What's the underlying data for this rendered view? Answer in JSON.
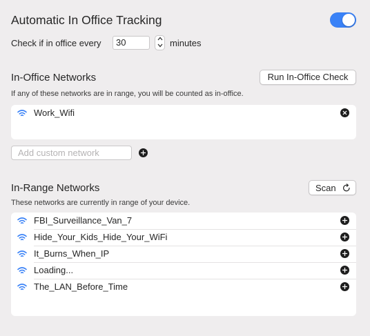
{
  "header": {
    "title": "Automatic In Office Tracking",
    "toggle_on": true
  },
  "interval": {
    "prefix": "Check if in office every",
    "value": "30",
    "suffix": "minutes"
  },
  "in_office": {
    "title": "In-Office Networks",
    "button": "Run In-Office Check",
    "description": "If any of these networks are in range, you will be counted as in-office.",
    "networks": [
      "Work_Wifi"
    ],
    "custom_placeholder": "Add custom network"
  },
  "in_range": {
    "title": "In-Range Networks",
    "button": "Scan",
    "description": "These networks are currently in range of your device.",
    "networks": [
      "FBI_Surveillance_Van_7",
      "Hide_Your_Kids_Hide_Your_WiFi",
      "It_Burns_When_IP",
      "Loading...",
      "The_LAN_Before_Time"
    ]
  },
  "colors": {
    "accent": "#3a82f7",
    "background": "#efedee"
  },
  "icons": {
    "network": "wifi-icon",
    "remove": "remove-circle-icon",
    "add": "add-circle-icon",
    "scan": "refresh-icon"
  }
}
